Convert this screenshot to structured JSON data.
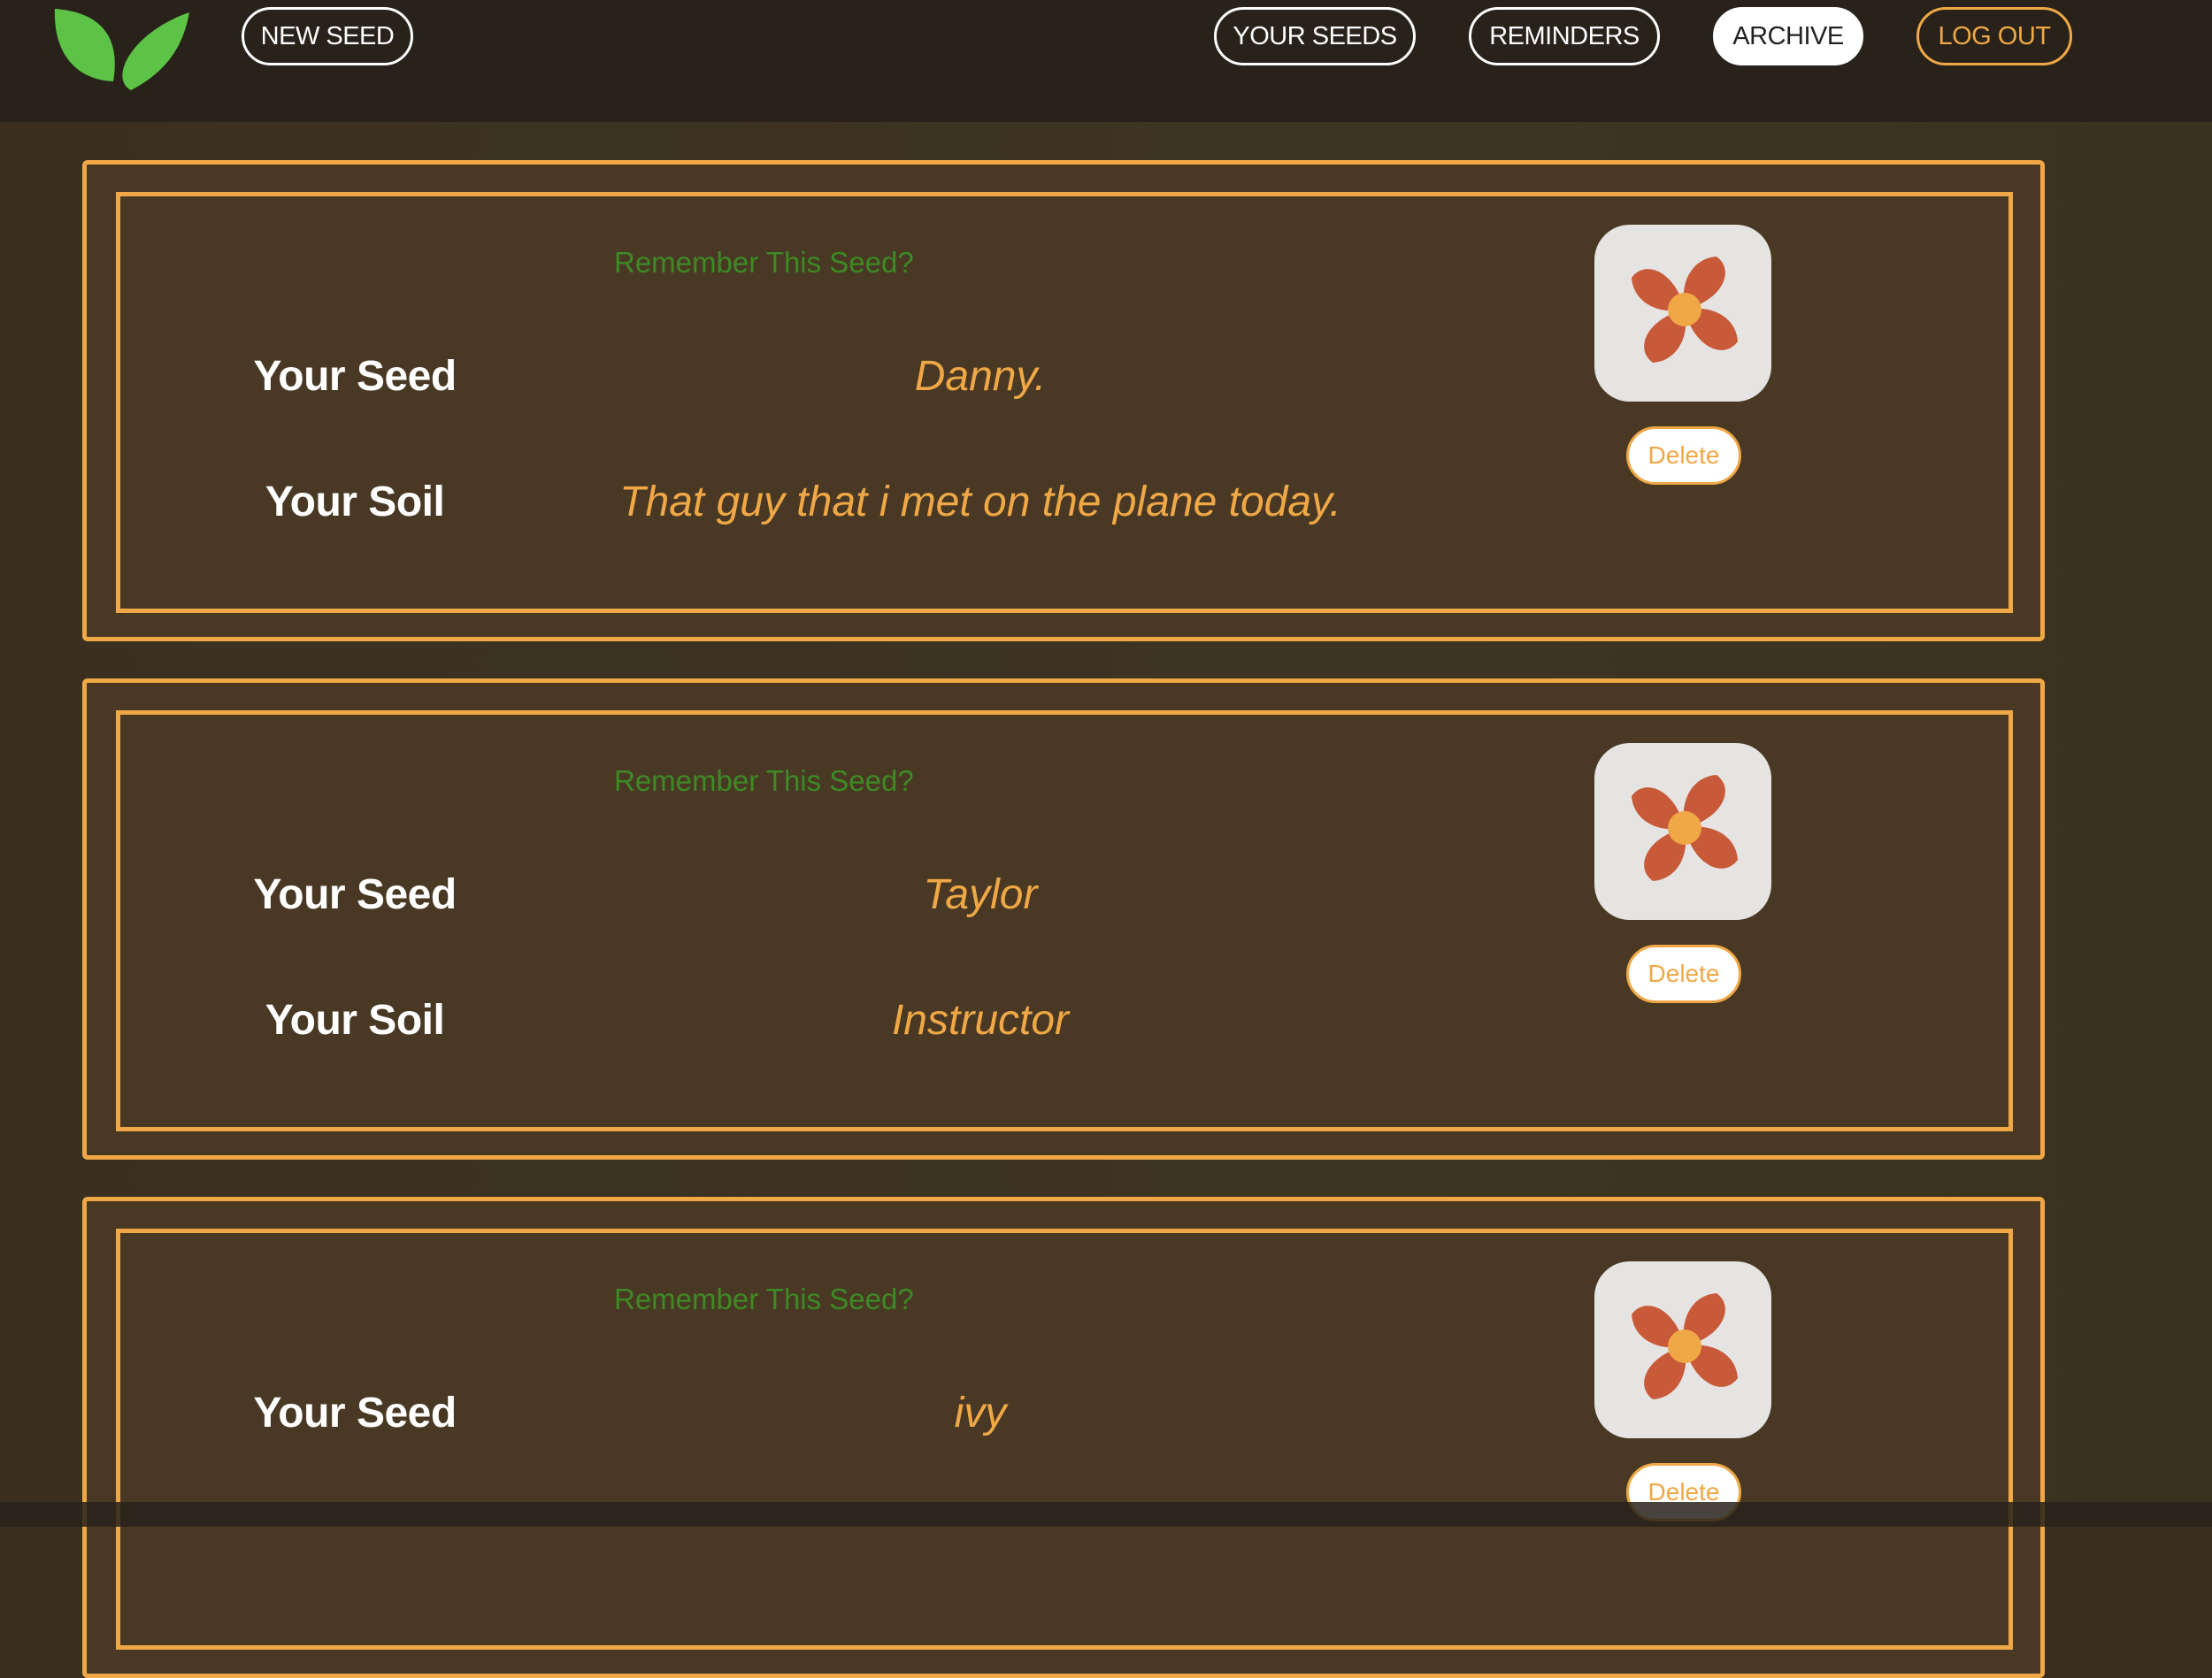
{
  "nav": {
    "new_seed": "NEW SEED",
    "your_seeds": "YOUR SEEDS",
    "reminders": "REMINDERS",
    "archive": "ARCHIVE",
    "logout": "LOG OUT",
    "active": "ARCHIVE"
  },
  "labels": {
    "remember": "Remember This Seed?",
    "your_seed": "Your Seed",
    "your_soil": "Your Soil",
    "delete": "Delete"
  },
  "seeds": [
    {
      "seed": "Danny.",
      "soil": "That guy that i met on the plane today."
    },
    {
      "seed": "Taylor",
      "soil": "Instructor"
    },
    {
      "seed": "ivy",
      "soil": ""
    }
  ],
  "colors": {
    "accent": "#f0a846",
    "green": "#3d8a25",
    "header_bg": "#28221a",
    "card_bg": "#493924",
    "flower": "#c85a3a",
    "flower_center": "#f0a846",
    "leaf": "#5cc346"
  },
  "icons": {
    "logo": "leaf-logo-icon",
    "card_image": "flower-icon"
  }
}
